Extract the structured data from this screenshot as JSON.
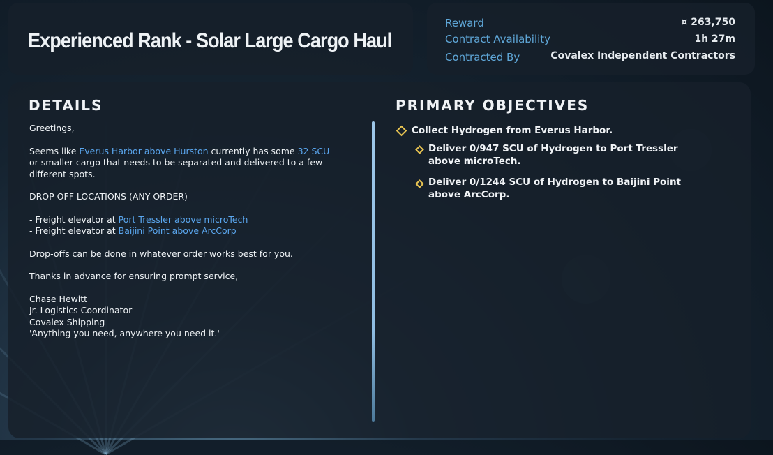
{
  "header": {
    "title": "Experienced Rank - Solar Large Cargo Haul"
  },
  "info": {
    "reward_label": "Reward",
    "reward_value": "¤ 263,750",
    "availability_label": "Contract Availability",
    "availability_value": "1h 27m",
    "contracted_by_label": "Contracted By",
    "contracted_by_value": "Covalex Independent Contractors"
  },
  "details": {
    "heading": "DETAILS",
    "greeting": "Greetings,",
    "p1_a": "Seems like ",
    "p1_loc": "Everus Harbor above Hurston",
    "p1_b": " currently has some ",
    "p1_scu": "32 SCU",
    "p1_c": " or smaller cargo that needs to be separated and delivered to a few different spots.",
    "dropoff_heading": "DROP OFF LOCATIONS (ANY ORDER)",
    "dropoff_prefix": "- Freight elevator at ",
    "dropoff_1": "Port Tressler above microTech",
    "dropoff_2": "Baijini Point above ArcCorp",
    "p_order": "Drop-offs can be done in whatever order works best for you.",
    "p_thanks": "Thanks in advance for ensuring prompt service,",
    "sig_name": "Chase Hewitt",
    "sig_title": "Jr. Logistics Coordinator",
    "sig_company": "Covalex Shipping",
    "sig_motto": "'Anything you need, anywhere you need it.'"
  },
  "objectives": {
    "heading": "PRIMARY OBJECTIVES",
    "main": "Collect Hydrogen from Everus Harbor.",
    "sub1_line1": "Deliver 0/947 SCU of Hydrogen to Port Tressler",
    "sub1_line2": "above microTech.",
    "sub2_line1": "Deliver 0/1244 SCU of Hydrogen to Baijini Point",
    "sub2_line2": "above ArcCorp."
  },
  "colors": {
    "accent_blue": "#5aa6ee",
    "label_blue": "#5fa7d8",
    "objective_gold": "#e8c452"
  }
}
